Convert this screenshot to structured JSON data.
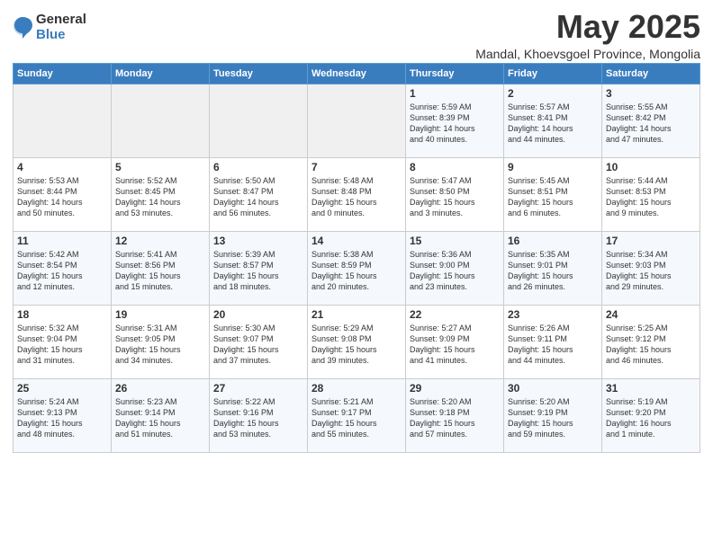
{
  "logo": {
    "general": "General",
    "blue": "Blue"
  },
  "title": "May 2025",
  "subtitle": "Mandal, Khoevsgoel Province, Mongolia",
  "days_of_week": [
    "Sunday",
    "Monday",
    "Tuesday",
    "Wednesday",
    "Thursday",
    "Friday",
    "Saturday"
  ],
  "weeks": [
    [
      {
        "day": "",
        "content": ""
      },
      {
        "day": "",
        "content": ""
      },
      {
        "day": "",
        "content": ""
      },
      {
        "day": "",
        "content": ""
      },
      {
        "day": "1",
        "content": "Sunrise: 5:59 AM\nSunset: 8:39 PM\nDaylight: 14 hours\nand 40 minutes."
      },
      {
        "day": "2",
        "content": "Sunrise: 5:57 AM\nSunset: 8:41 PM\nDaylight: 14 hours\nand 44 minutes."
      },
      {
        "day": "3",
        "content": "Sunrise: 5:55 AM\nSunset: 8:42 PM\nDaylight: 14 hours\nand 47 minutes."
      }
    ],
    [
      {
        "day": "4",
        "content": "Sunrise: 5:53 AM\nSunset: 8:44 PM\nDaylight: 14 hours\nand 50 minutes."
      },
      {
        "day": "5",
        "content": "Sunrise: 5:52 AM\nSunset: 8:45 PM\nDaylight: 14 hours\nand 53 minutes."
      },
      {
        "day": "6",
        "content": "Sunrise: 5:50 AM\nSunset: 8:47 PM\nDaylight: 14 hours\nand 56 minutes."
      },
      {
        "day": "7",
        "content": "Sunrise: 5:48 AM\nSunset: 8:48 PM\nDaylight: 15 hours\nand 0 minutes."
      },
      {
        "day": "8",
        "content": "Sunrise: 5:47 AM\nSunset: 8:50 PM\nDaylight: 15 hours\nand 3 minutes."
      },
      {
        "day": "9",
        "content": "Sunrise: 5:45 AM\nSunset: 8:51 PM\nDaylight: 15 hours\nand 6 minutes."
      },
      {
        "day": "10",
        "content": "Sunrise: 5:44 AM\nSunset: 8:53 PM\nDaylight: 15 hours\nand 9 minutes."
      }
    ],
    [
      {
        "day": "11",
        "content": "Sunrise: 5:42 AM\nSunset: 8:54 PM\nDaylight: 15 hours\nand 12 minutes."
      },
      {
        "day": "12",
        "content": "Sunrise: 5:41 AM\nSunset: 8:56 PM\nDaylight: 15 hours\nand 15 minutes."
      },
      {
        "day": "13",
        "content": "Sunrise: 5:39 AM\nSunset: 8:57 PM\nDaylight: 15 hours\nand 18 minutes."
      },
      {
        "day": "14",
        "content": "Sunrise: 5:38 AM\nSunset: 8:59 PM\nDaylight: 15 hours\nand 20 minutes."
      },
      {
        "day": "15",
        "content": "Sunrise: 5:36 AM\nSunset: 9:00 PM\nDaylight: 15 hours\nand 23 minutes."
      },
      {
        "day": "16",
        "content": "Sunrise: 5:35 AM\nSunset: 9:01 PM\nDaylight: 15 hours\nand 26 minutes."
      },
      {
        "day": "17",
        "content": "Sunrise: 5:34 AM\nSunset: 9:03 PM\nDaylight: 15 hours\nand 29 minutes."
      }
    ],
    [
      {
        "day": "18",
        "content": "Sunrise: 5:32 AM\nSunset: 9:04 PM\nDaylight: 15 hours\nand 31 minutes."
      },
      {
        "day": "19",
        "content": "Sunrise: 5:31 AM\nSunset: 9:05 PM\nDaylight: 15 hours\nand 34 minutes."
      },
      {
        "day": "20",
        "content": "Sunrise: 5:30 AM\nSunset: 9:07 PM\nDaylight: 15 hours\nand 37 minutes."
      },
      {
        "day": "21",
        "content": "Sunrise: 5:29 AM\nSunset: 9:08 PM\nDaylight: 15 hours\nand 39 minutes."
      },
      {
        "day": "22",
        "content": "Sunrise: 5:27 AM\nSunset: 9:09 PM\nDaylight: 15 hours\nand 41 minutes."
      },
      {
        "day": "23",
        "content": "Sunrise: 5:26 AM\nSunset: 9:11 PM\nDaylight: 15 hours\nand 44 minutes."
      },
      {
        "day": "24",
        "content": "Sunrise: 5:25 AM\nSunset: 9:12 PM\nDaylight: 15 hours\nand 46 minutes."
      }
    ],
    [
      {
        "day": "25",
        "content": "Sunrise: 5:24 AM\nSunset: 9:13 PM\nDaylight: 15 hours\nand 48 minutes."
      },
      {
        "day": "26",
        "content": "Sunrise: 5:23 AM\nSunset: 9:14 PM\nDaylight: 15 hours\nand 51 minutes."
      },
      {
        "day": "27",
        "content": "Sunrise: 5:22 AM\nSunset: 9:16 PM\nDaylight: 15 hours\nand 53 minutes."
      },
      {
        "day": "28",
        "content": "Sunrise: 5:21 AM\nSunset: 9:17 PM\nDaylight: 15 hours\nand 55 minutes."
      },
      {
        "day": "29",
        "content": "Sunrise: 5:20 AM\nSunset: 9:18 PM\nDaylight: 15 hours\nand 57 minutes."
      },
      {
        "day": "30",
        "content": "Sunrise: 5:20 AM\nSunset: 9:19 PM\nDaylight: 15 hours\nand 59 minutes."
      },
      {
        "day": "31",
        "content": "Sunrise: 5:19 AM\nSunset: 9:20 PM\nDaylight: 16 hours\nand 1 minute."
      }
    ]
  ]
}
